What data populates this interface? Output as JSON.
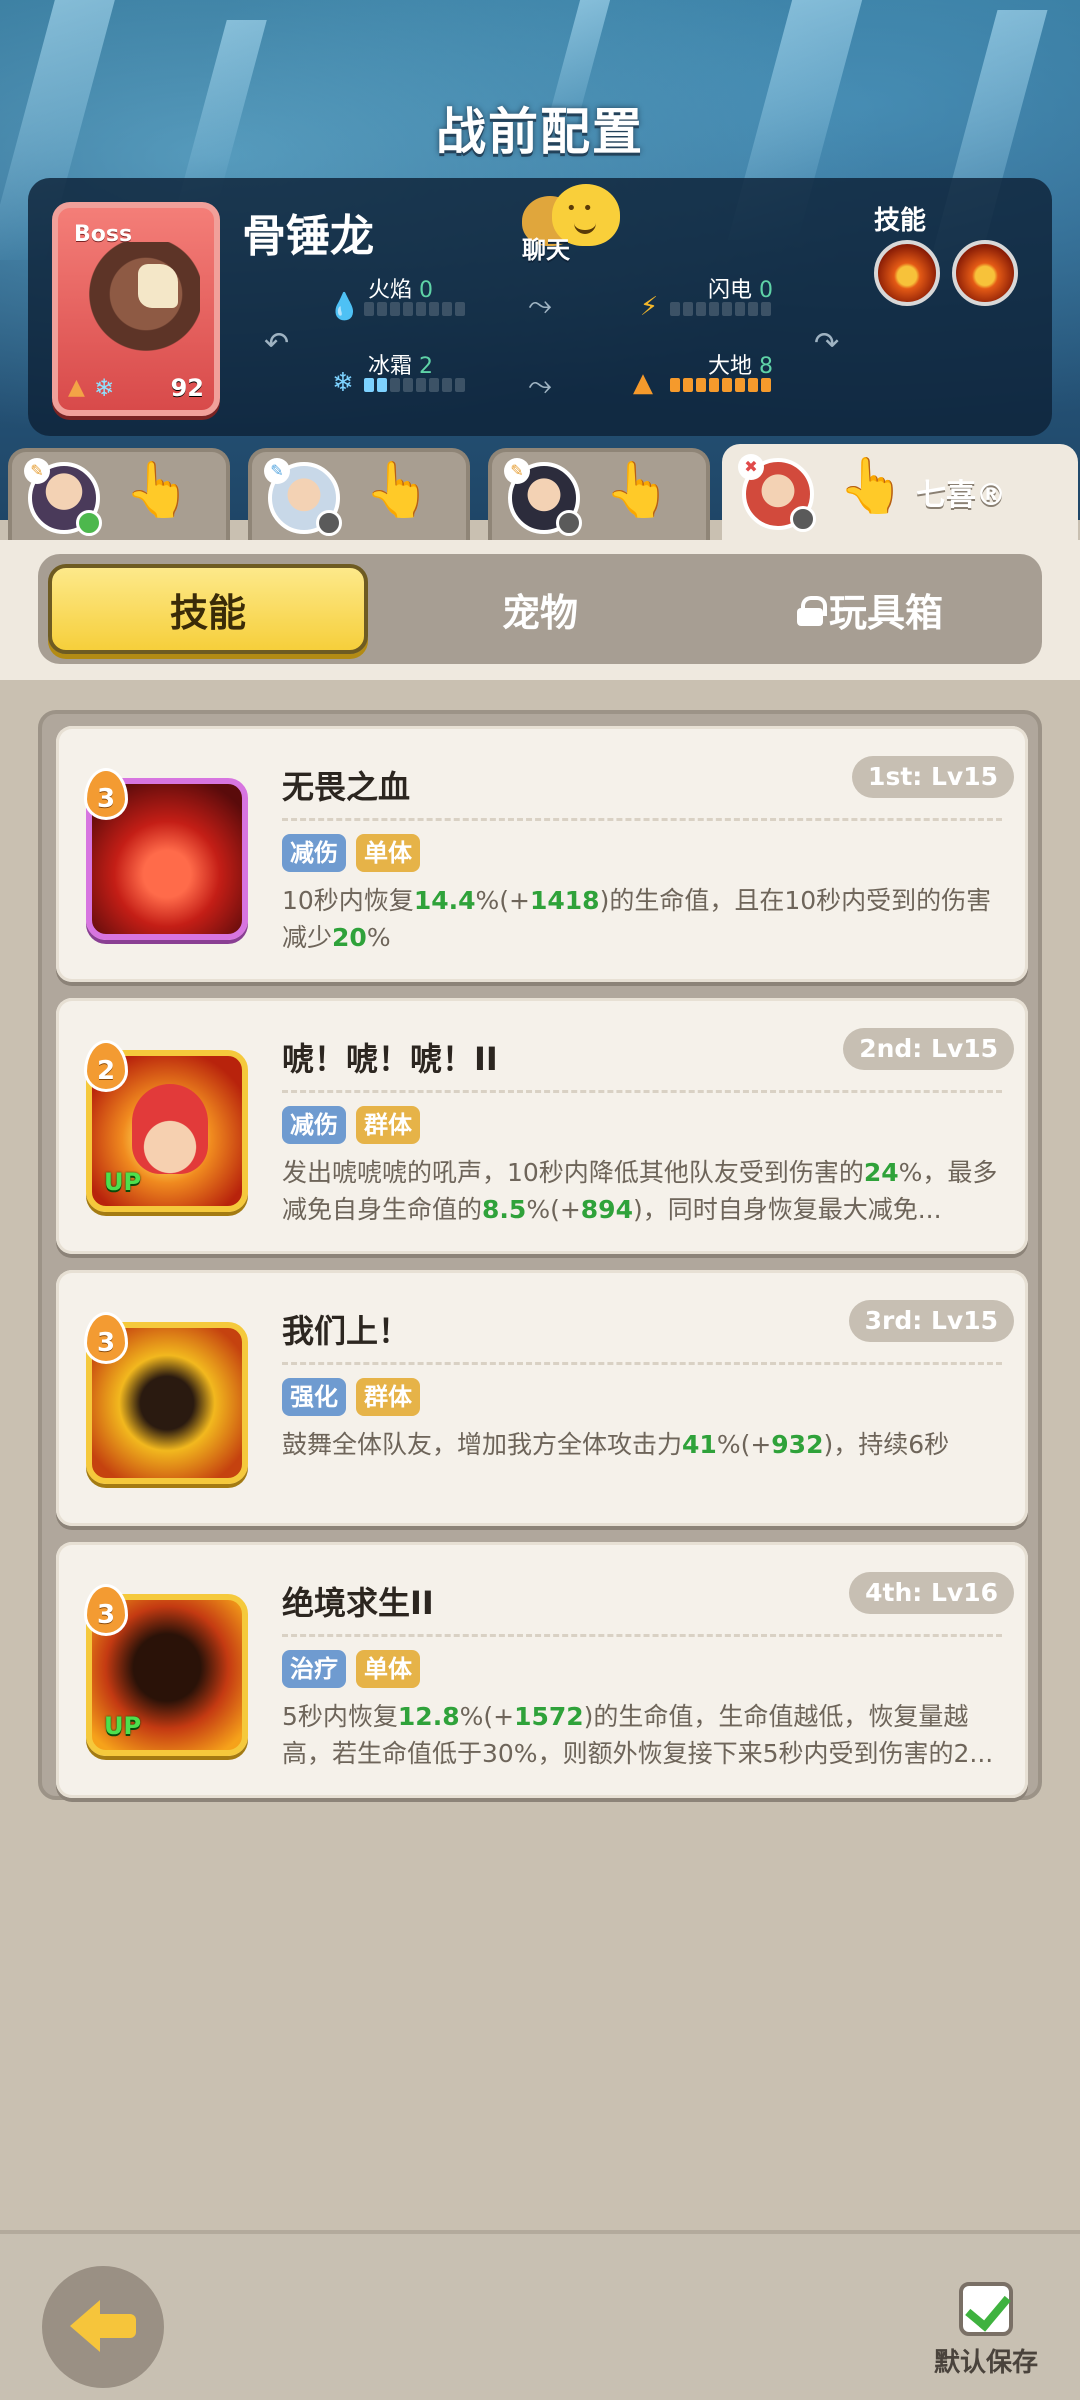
{
  "header": {
    "title": "战前配置"
  },
  "boss": {
    "tag": "Boss",
    "name": "骨锤龙",
    "level": "92",
    "chat_label": "聊天",
    "skills_label": "技能",
    "stats": [
      {
        "name": "火焰",
        "value": "0",
        "color": "#e23a2a",
        "icon": "fire-icon"
      },
      {
        "name": "闪电",
        "value": "0",
        "color": "#f3b72a",
        "icon": "lightning-icon"
      },
      {
        "name": "冰霜",
        "value": "2",
        "color": "#7dd2ff",
        "icon": "frost-icon"
      },
      {
        "name": "大地",
        "value": "8",
        "color": "#f59a2c",
        "icon": "earth-icon"
      }
    ]
  },
  "heroes": [
    {
      "name": "",
      "active": false
    },
    {
      "name": "",
      "active": false
    },
    {
      "name": "",
      "active": false
    },
    {
      "name": "七喜®",
      "active": true
    }
  ],
  "tabs": [
    {
      "label": "技能",
      "active": true
    },
    {
      "label": "宠物",
      "active": false
    },
    {
      "label": "玩具箱",
      "active": false,
      "locked": true
    }
  ],
  "skills": [
    {
      "level_badge": "3",
      "title": "无畏之血",
      "rank": "1st: Lv15",
      "tags": [
        "减伤",
        "单体"
      ],
      "desc_parts": [
        "10秒内恢复",
        "14.4",
        "%(+",
        "1418",
        ")的生命值，且在10秒内受到的伤害减少",
        "20",
        "%"
      ],
      "upgrade": ""
    },
    {
      "level_badge": "2",
      "title": "唬！唬！唬！II",
      "rank": "2nd: Lv15",
      "tags": [
        "减伤",
        "群体"
      ],
      "desc_parts": [
        "发出唬唬唬的吼声，10秒内降低其他队友受到伤害的",
        "24",
        "%，最多减免自身生命值的",
        "8.5",
        "%(+",
        "894",
        ")，同时自身恢复最大减免..."
      ],
      "upgrade": "UP"
    },
    {
      "level_badge": "3",
      "title": "我们上！",
      "rank": "3rd: Lv15",
      "tags": [
        "强化",
        "群体"
      ],
      "desc_parts": [
        "鼓舞全体队友，增加我方全体攻击力",
        "41",
        "%(+",
        "932",
        ")，持续6秒"
      ],
      "upgrade": ""
    },
    {
      "level_badge": "3",
      "title": "绝境求生II",
      "rank": "4th: Lv16",
      "tags": [
        "治疗",
        "单体"
      ],
      "desc_parts": [
        "5秒内恢复",
        "12.8",
        "%(+",
        "1572",
        ")的生命值，生命值越低，恢复量越高，若生命值低于30%，则额外恢复接下来5秒内受到伤害的2..."
      ],
      "upgrade": "UP"
    }
  ],
  "footer": {
    "save_label": "默认保存"
  }
}
